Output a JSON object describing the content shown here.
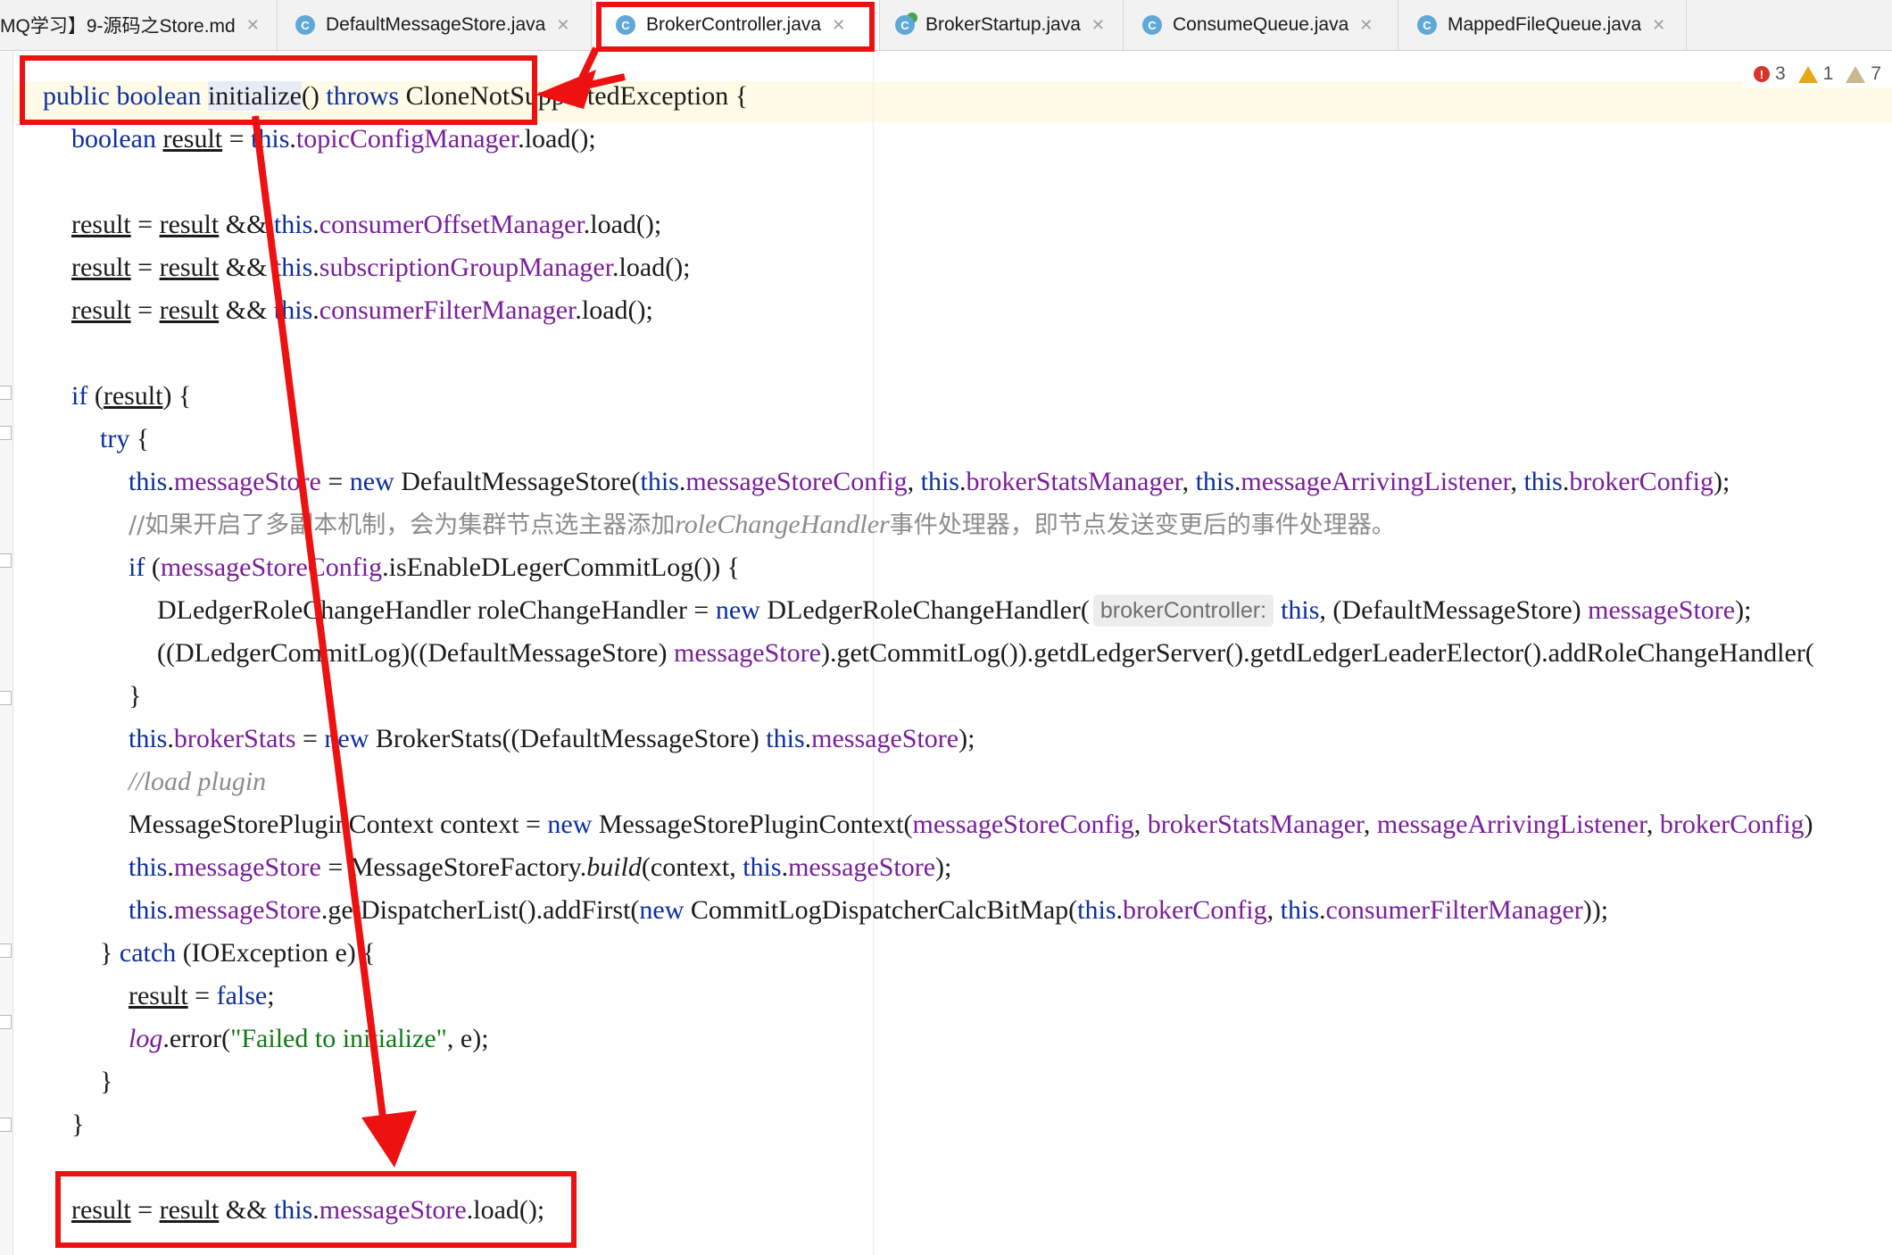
{
  "tabs": [
    {
      "label": "MQ学习】9-源码之Store.md",
      "icon": "markdown-file-icon"
    },
    {
      "label": "DefaultMessageStore.java",
      "icon": "class-icon"
    },
    {
      "label": "BrokerController.java",
      "icon": "class-icon",
      "active": true
    },
    {
      "label": "BrokerStartup.java",
      "icon": "runnable-class-icon"
    },
    {
      "label": "ConsumeQueue.java",
      "icon": "class-icon"
    },
    {
      "label": "MappedFileQueue.java",
      "icon": "class-icon"
    }
  ],
  "inspections": {
    "errors": "3",
    "warnings": "1",
    "weak_warnings": "7"
  },
  "code": {
    "l01": {
      "a": "public boolean ",
      "b": "initialize",
      "c": "() ",
      "d": "throws",
      "e": " CloneNotSupportedException {"
    },
    "l02": {
      "a": "boolean ",
      "b": "result",
      "c": " = ",
      "d": "this",
      "e": ".",
      "f": "topicConfigManager",
      "g": ".load();"
    },
    "l03": {
      "a": "result",
      "b": " = ",
      "c": "result",
      "d": " && ",
      "e": "this",
      "f": ".",
      "g": "consumerOffsetManager",
      "h": ".load();"
    },
    "l04": {
      "a": "result",
      "b": " = ",
      "c": "result",
      "d": " && ",
      "e": "this",
      "f": ".",
      "g": "subscriptionGroupManager",
      "h": ".load();"
    },
    "l05": {
      "a": "result",
      "b": " = ",
      "c": "result",
      "d": " && ",
      "e": "this",
      "f": ".",
      "g": "consumerFilterManager",
      "h": ".load();"
    },
    "l06": {
      "a": "if",
      "b": " (",
      "c": "result",
      "d": ") {"
    },
    "l07": {
      "a": "try",
      "b": " {"
    },
    "l08": {
      "a": "this",
      "b": ".",
      "c": "messageStore",
      "d": " = ",
      "e": "new",
      "f": " DefaultMessageStore(",
      "g": "this",
      "h": ".",
      "i": "messageStoreConfig",
      "j": ", ",
      "k": "this",
      "l": ".",
      "m": "brokerStatsManager",
      "n": ", ",
      "o": "this",
      "p": ".",
      "q": "messageArrivingListener",
      "r": ", ",
      "s": "this",
      "t": ".",
      "u": "brokerConfig",
      "v": ");"
    },
    "l09": {
      "a": "//如果开启了多副本机制，会为集群节点选主器添加",
      "b": "roleChangeHandler",
      "c": "事件处理器，即节点发送变更后的事件处理器。"
    },
    "l10": {
      "a": "if",
      "b": " (",
      "c": "messageStoreConfig",
      "d": ".isEnableDLegerCommitLog()) {"
    },
    "l11": {
      "a": "DLedgerRoleChangeHandler roleChangeHandler = ",
      "b": "new",
      "c": " DLedgerRoleChangeHandler(",
      "d": "brokerController:",
      "e": "this",
      "f": ", (DefaultMessageStore) ",
      "g": "messageStore",
      "h": ");"
    },
    "l12": {
      "a": "((DLedgerCommitLog)((DefaultMessageStore) ",
      "b": "messageStore",
      "c": ").getCommitLog()).getdLedgerServer().getdLedgerLeaderElector().addRoleChangeHandler("
    },
    "l13": {
      "a": "}"
    },
    "l14": {
      "a": "this",
      "b": ".",
      "c": "brokerStats",
      "d": " = ",
      "e": "new",
      "f": " BrokerStats((DefaultMessageStore) ",
      "g": "this",
      "h": ".",
      "i": "messageStore",
      "j": ");"
    },
    "l15": {
      "a": "//load plugin"
    },
    "l16": {
      "a": "MessageStorePluginContext context = ",
      "b": "new",
      "c": " MessageStorePluginContext(",
      "d": "messageStoreConfig",
      "e": ", ",
      "f": "brokerStatsManager",
      "g": ", ",
      "h": "messageArrivingListener",
      "i": ", ",
      "j": "brokerConfig",
      "k": ")"
    },
    "l17": {
      "a": "this",
      "b": ".",
      "c": "messageStore",
      "d": " = MessageStoreFactory.",
      "e": "build",
      "f": "(context, ",
      "g": "this",
      "h": ".",
      "i": "messageStore",
      "j": ");"
    },
    "l18": {
      "a": "this",
      "b": ".",
      "c": "messageStore",
      "d": ".getDispatcherList().addFirst(",
      "e": "new",
      "f": " CommitLogDispatcherCalcBitMap(",
      "g": "this",
      "h": ".",
      "i": "brokerConfig",
      "j": ", ",
      "k": "this",
      "l": ".",
      "m": "consumerFilterManager",
      "n": "));"
    },
    "l19": {
      "a": "} ",
      "b": "catch",
      "c": " (IOException e) {"
    },
    "l20": {
      "a": "result",
      "b": " = ",
      "c": "false",
      "d": ";"
    },
    "l21": {
      "a": "log",
      "b": ".error(",
      "c": "\"Failed to initialize\"",
      "d": ", e);"
    },
    "l22": {
      "a": "}"
    },
    "l23": {
      "a": "}"
    },
    "l24": {
      "a": "result",
      "b": " = ",
      "c": "result",
      "d": " && ",
      "e": "this",
      "f": ".",
      "g": "messageStore",
      "h": ".load();"
    }
  },
  "colors": {
    "annotation": "#ee1111",
    "keyword": "#0b2fa0",
    "field": "#7a1e9b",
    "string": "#0f7a14"
  }
}
